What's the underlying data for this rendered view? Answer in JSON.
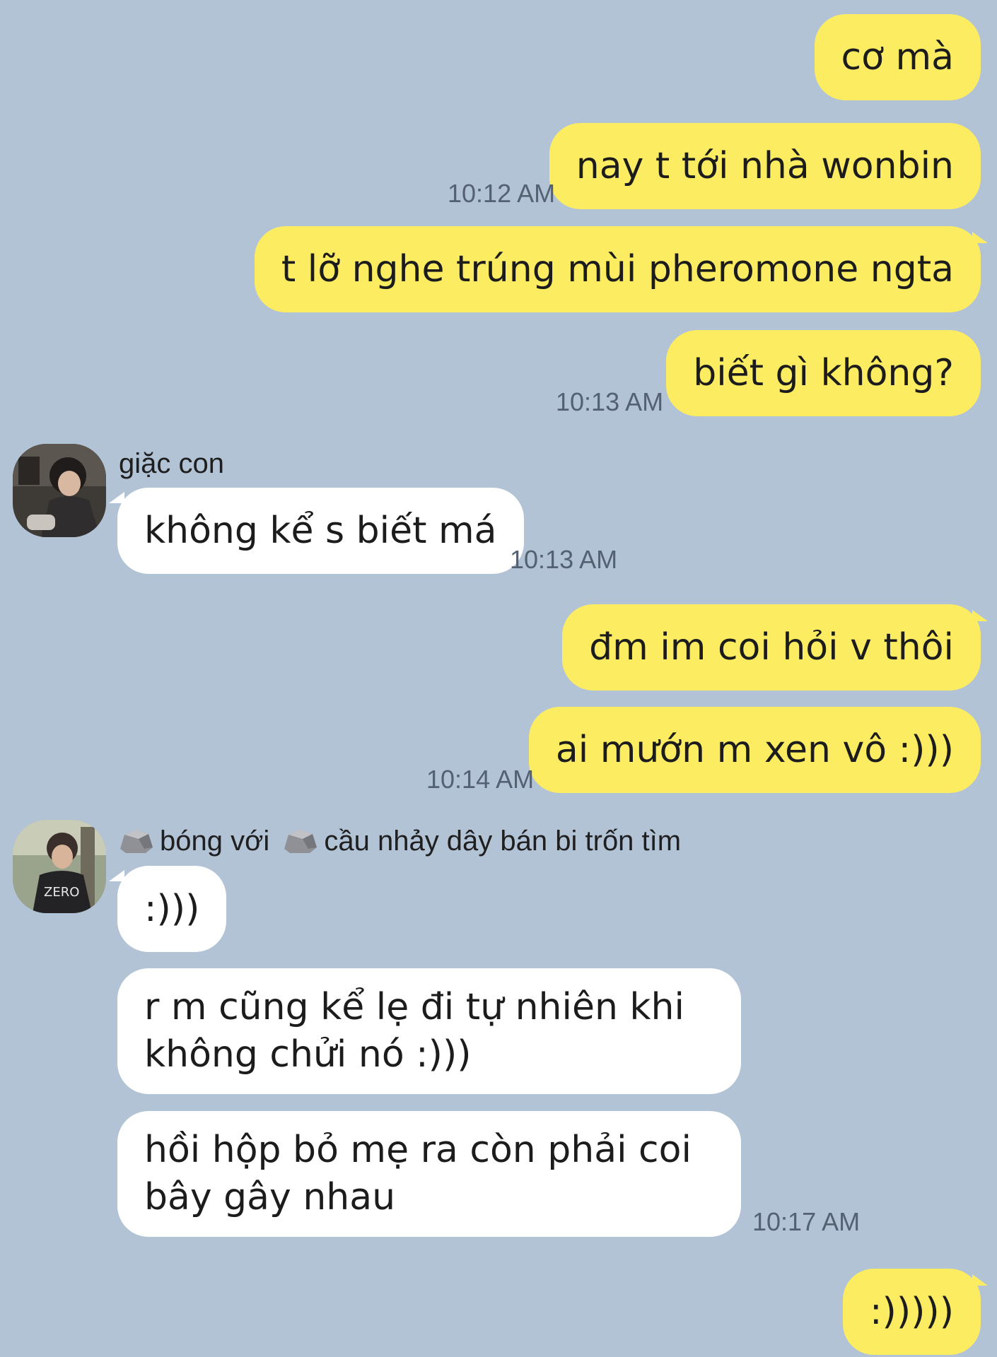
{
  "chat": {
    "my_color": "#fcec62",
    "their_color": "#ffffff",
    "background": "#b3c3d6",
    "messages_me_1": [
      "cơ mà",
      "nay t tới nhà wonbin",
      "t lỡ nghe trúng mùi pheromone ngta",
      "biết gì không?"
    ],
    "time_me_1a": "10:12 AM",
    "time_me_1b": "10:13 AM",
    "sender_1": "giặc con",
    "msg_them_1": "không kể s biết má",
    "time_them_1": "10:13 AM",
    "messages_me_2": [
      "đm im coi hỏi v thôi",
      "ai mướn m xen vô :)))"
    ],
    "time_me_2": "10:14 AM",
    "sender_2_part1": "bóng với",
    "sender_2_part2": "cầu nhảy dây bán bi trốn tìm",
    "sender_2_icon": "rock-icon",
    "msg_them_2a": ":)))",
    "msg_them_2b": "r m cũng kể lẹ đi tự nhiên khi không chửi nó :)))",
    "msg_them_2c": "hồi hộp bỏ mẹ ra còn phải coi bây gây nhau",
    "time_them_2": "10:17 AM",
    "msg_me_3": ":)))))"
  }
}
